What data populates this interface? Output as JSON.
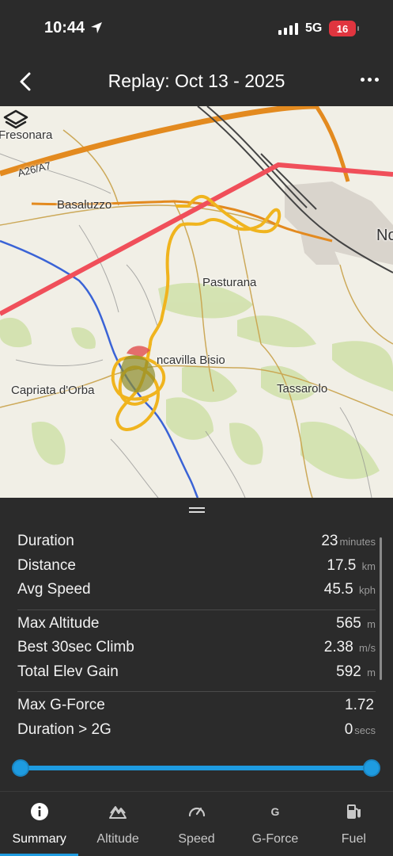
{
  "status": {
    "time": "10:44",
    "network": "5G",
    "battery": "16"
  },
  "header": {
    "title": "Replay:  Oct 13 - 2025"
  },
  "map": {
    "labels": {
      "fresonara": "Fresonara",
      "highway": "A26/A7",
      "basaluzzo": "Basaluzzo",
      "pasturana": "Pasturana",
      "novi": "No",
      "francavilla": "ncavilla Bisio",
      "tassarolo": "Tassarolo",
      "capriata": "Capriata d'Orba"
    },
    "colors": {
      "track": "#f0b41e",
      "airspace": "#f04f5a",
      "river": "#3a63d6",
      "road": "#e38a1f"
    }
  },
  "stats": {
    "group1": [
      {
        "label": "Duration",
        "value": "23",
        "unit": "minutes"
      },
      {
        "label": "Distance",
        "value": "17.5",
        "unit": "km"
      },
      {
        "label": "Avg Speed",
        "value": "45.5",
        "unit": "kph"
      }
    ],
    "group2": [
      {
        "label": "Max Altitude",
        "value": "565",
        "unit": "m"
      },
      {
        "label": "Best 30sec Climb",
        "value": "2.38",
        "unit": "m/s"
      },
      {
        "label": "Total Elev Gain",
        "value": "592",
        "unit": "m"
      }
    ],
    "group3": [
      {
        "label": "Max G-Force",
        "value": "1.72",
        "unit": ""
      },
      {
        "label": "Duration > 2G",
        "value": "0",
        "unit": "secs"
      }
    ]
  },
  "slider": {
    "start_fraction": 0,
    "end_fraction": 1
  },
  "tabs": [
    {
      "label": "Summary",
      "icon": "info-icon",
      "active": true
    },
    {
      "label": "Altitude",
      "icon": "mountain-icon",
      "active": false
    },
    {
      "label": "Speed",
      "icon": "speedometer-icon",
      "active": false
    },
    {
      "label": "G-Force",
      "icon": "g-icon",
      "active": false
    },
    {
      "label": "Fuel",
      "icon": "fuel-pump-icon",
      "active": false
    }
  ]
}
